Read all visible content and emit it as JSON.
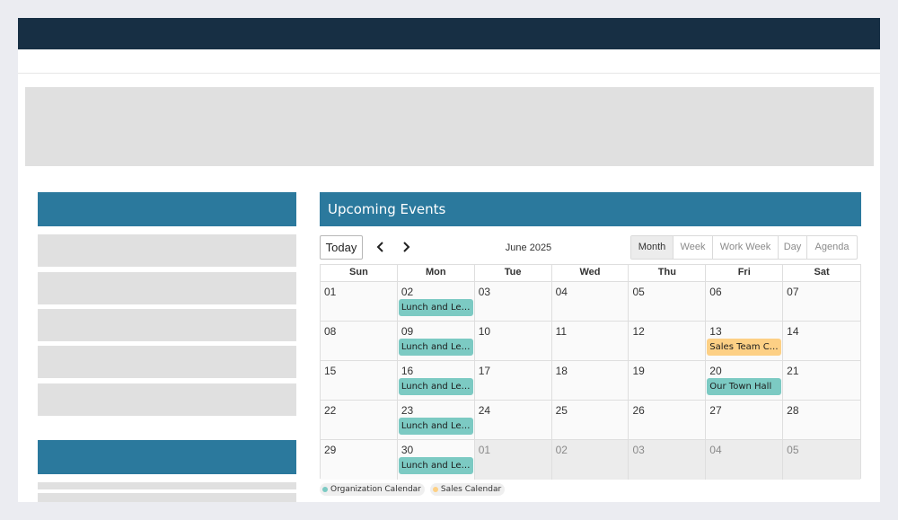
{
  "colors": {
    "brand_navy": "#172f44",
    "section_header": "#2b799d",
    "org_event": "#7ccac3",
    "sales_event": "#fdd085"
  },
  "events_panel": {
    "title": "Upcoming Events"
  },
  "toolbar": {
    "today_label": "Today",
    "prev_icon": "chevron-left-icon",
    "next_icon": "chevron-right-icon",
    "month_label": "June 2025",
    "views": [
      {
        "label": "Month",
        "active": true
      },
      {
        "label": "Week",
        "active": false
      },
      {
        "label": "Work Week",
        "active": false
      },
      {
        "label": "Day",
        "active": false
      },
      {
        "label": "Agenda",
        "active": false
      }
    ]
  },
  "calendar": {
    "days_of_week": [
      "Sun",
      "Mon",
      "Tue",
      "Wed",
      "Thu",
      "Fri",
      "Sat"
    ],
    "weeks": [
      [
        {
          "day": "01",
          "off": false
        },
        {
          "day": "02",
          "off": false,
          "event": {
            "label": "Lunch and Learn",
            "cal": "org"
          }
        },
        {
          "day": "03",
          "off": false
        },
        {
          "day": "04",
          "off": false
        },
        {
          "day": "05",
          "off": false
        },
        {
          "day": "06",
          "off": false
        },
        {
          "day": "07",
          "off": false
        }
      ],
      [
        {
          "day": "08",
          "off": false
        },
        {
          "day": "09",
          "off": false,
          "event": {
            "label": "Lunch and Learn",
            "cal": "org"
          }
        },
        {
          "day": "10",
          "off": false
        },
        {
          "day": "11",
          "off": false
        },
        {
          "day": "12",
          "off": false
        },
        {
          "day": "13",
          "off": false,
          "event": {
            "label": "Sales Team C…",
            "cal": "sales"
          }
        },
        {
          "day": "14",
          "off": false
        }
      ],
      [
        {
          "day": "15",
          "off": false
        },
        {
          "day": "16",
          "off": false,
          "event": {
            "label": "Lunch and Learn",
            "cal": "org"
          }
        },
        {
          "day": "17",
          "off": false
        },
        {
          "day": "18",
          "off": false
        },
        {
          "day": "19",
          "off": false
        },
        {
          "day": "20",
          "off": false,
          "event": {
            "label": "Our Town Hall",
            "cal": "org"
          }
        },
        {
          "day": "21",
          "off": false
        }
      ],
      [
        {
          "day": "22",
          "off": false
        },
        {
          "day": "23",
          "off": false,
          "event": {
            "label": "Lunch and Learn",
            "cal": "org"
          }
        },
        {
          "day": "24",
          "off": false
        },
        {
          "day": "25",
          "off": false
        },
        {
          "day": "26",
          "off": false
        },
        {
          "day": "27",
          "off": false
        },
        {
          "day": "28",
          "off": false
        }
      ],
      [
        {
          "day": "29",
          "off": false
        },
        {
          "day": "30",
          "off": false,
          "event": {
            "label": "Lunch and Learn",
            "cal": "org"
          }
        },
        {
          "day": "01",
          "off": true
        },
        {
          "day": "02",
          "off": true
        },
        {
          "day": "03",
          "off": true
        },
        {
          "day": "04",
          "off": true
        },
        {
          "day": "05",
          "off": true
        }
      ]
    ]
  },
  "legend": [
    {
      "label": "Organization Calendar",
      "color": "#7ccac3"
    },
    {
      "label": "Sales Calendar",
      "color": "#fdd085"
    }
  ]
}
